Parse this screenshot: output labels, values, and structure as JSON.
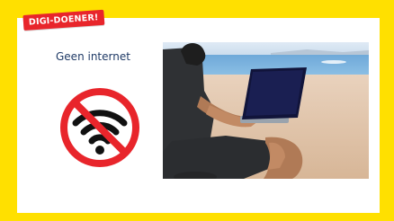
{
  "badge": {
    "label": "DIGI-DOENER!"
  },
  "caption": {
    "text": "Geen internet"
  },
  "icons": {
    "no_wifi": "no-wifi-icon",
    "photo": "beach-laptop-photo"
  },
  "colors": {
    "frame": "#ffe000",
    "badge": "#e8252b",
    "caption": "#1f3a66",
    "prohibition": "#e8252b"
  }
}
